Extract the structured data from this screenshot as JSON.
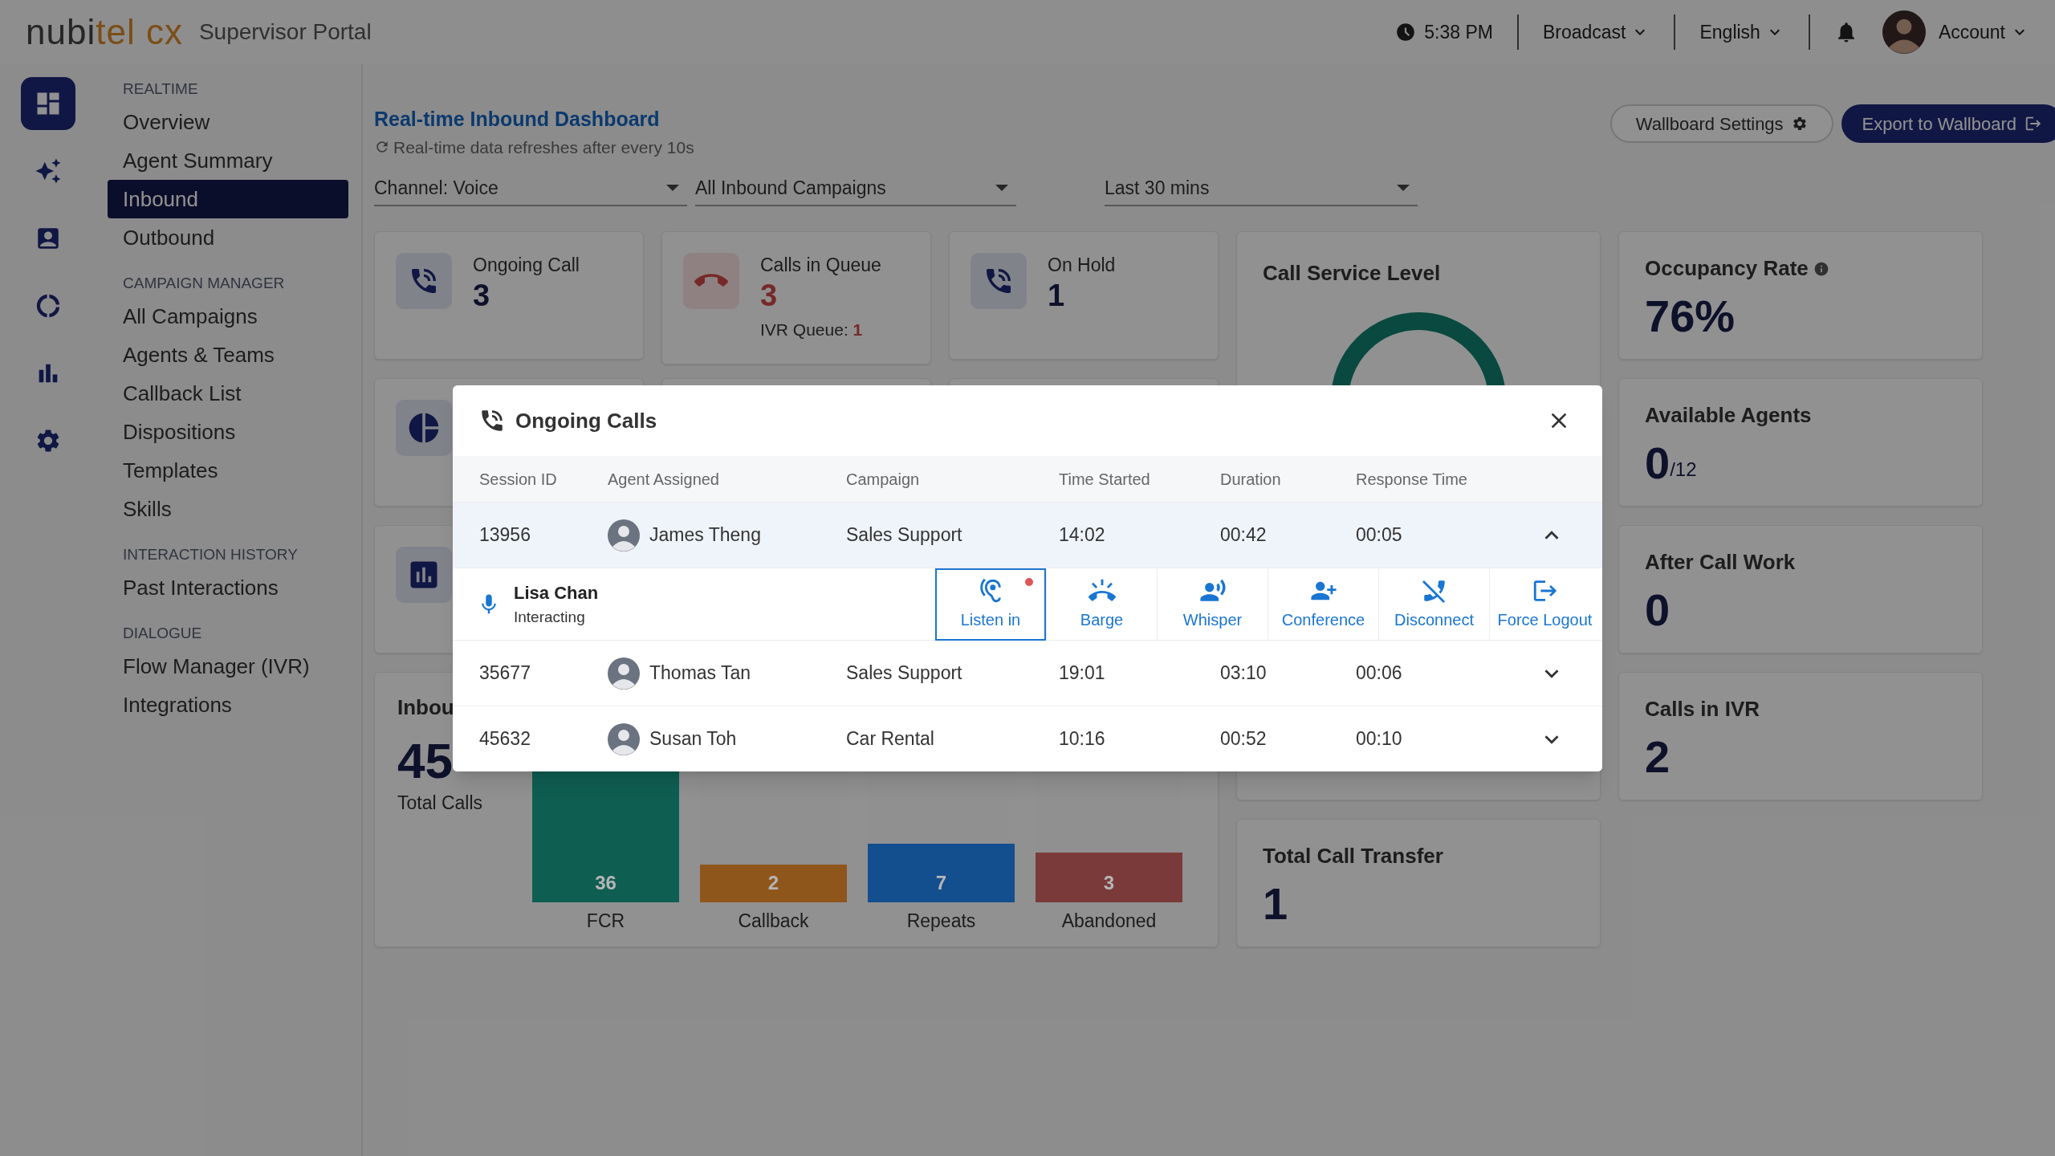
{
  "header": {
    "logo": {
      "main": "nubi",
      "accent": "tel cx"
    },
    "app_name": "Supervisor Portal",
    "time": "5:38 PM",
    "menus": [
      "Broadcast",
      "English"
    ],
    "account": "Account"
  },
  "rail": [
    {
      "selected": true
    },
    {
      "selected": false
    },
    {
      "selected": false
    },
    {
      "selected": false
    },
    {
      "selected": false
    },
    {
      "selected": false
    }
  ],
  "sidebar": [
    {
      "heading": "REALTIME",
      "items": [
        {
          "label": "Overview",
          "selected": false
        },
        {
          "label": "Agent Summary",
          "selected": false
        },
        {
          "label": "Inbound",
          "selected": true
        },
        {
          "label": "Outbound",
          "selected": false
        }
      ]
    },
    {
      "heading": "CAMPAIGN MANAGER",
      "items": [
        {
          "label": "All Campaigns",
          "selected": false
        },
        {
          "label": "Agents & Teams",
          "selected": false
        },
        {
          "label": "Callback List",
          "selected": false
        },
        {
          "label": "Dispositions",
          "selected": false
        },
        {
          "label": "Templates",
          "selected": false
        },
        {
          "label": "Skills",
          "selected": false
        }
      ]
    },
    {
      "heading": "INTERACTION HISTORY",
      "items": [
        {
          "label": "Past Interactions",
          "selected": false
        }
      ]
    },
    {
      "heading": "DIALOGUE",
      "items": [
        {
          "label": "Flow Manager (IVR)",
          "selected": false
        },
        {
          "label": "Integrations",
          "selected": false
        }
      ]
    }
  ],
  "page": {
    "title": "Real-time Inbound Dashboard",
    "subtitle": "Real-time data refreshes after every 10s",
    "buttons": [
      {
        "label": "Wallboard Settings",
        "kind": "outline"
      },
      {
        "label": "Export to Wallboard",
        "kind": "primary"
      }
    ]
  },
  "filters": [
    "Channel: Voice",
    "All Inbound Campaigns",
    "Last 30 mins"
  ],
  "stat_cards": [
    {
      "kind": "normal",
      "title": "Ongoing Call",
      "value": "3"
    },
    {
      "kind": "alert",
      "title": "Calls in Queue",
      "value": "3",
      "sub_label": "IVR Queue:",
      "sub_value": "1"
    },
    {
      "kind": "normal",
      "title": "On Hold",
      "value": "1"
    }
  ],
  "hidden_cards": [
    {
      "kind": "pie"
    },
    {
      "kind": "blank"
    },
    {
      "kind": "blank"
    },
    {
      "kind": "chart"
    },
    {
      "kind": "blank"
    },
    {
      "kind": "blank"
    }
  ],
  "service_level": {
    "title": "Call Service Level"
  },
  "inbound": {
    "title": "Inbou",
    "total": "45",
    "total_label": "Total Calls",
    "bars": [
      {
        "label": "FCR",
        "value": "36",
        "color": "#0f5e52",
        "level": 1
      },
      {
        "label": "Callback",
        "value": "2",
        "color": "#8f561c",
        "level": 0.18
      },
      {
        "label": "Repeats",
        "value": "7",
        "color": "#134f8e",
        "level": 0.28
      },
      {
        "label": "Abandoned",
        "value": "3",
        "color": "#7b3a3a",
        "level": 0.24
      }
    ]
  },
  "transfer": {
    "title": "Total Call Transfer",
    "value": "1"
  },
  "right_cards": [
    {
      "title": "Occupancy Rate",
      "value": "76%",
      "info": true
    },
    {
      "title": "Available Agents",
      "value": "0",
      "suffix": "/12",
      "info": false
    },
    {
      "title": "After Call Work",
      "value": "0",
      "info": false
    },
    {
      "title": "Calls in IVR",
      "value": "2",
      "info": false
    }
  ],
  "modal": {
    "title": "Ongoing Calls",
    "columns": [
      "Session ID",
      "Agent Assigned",
      "Campaign",
      "Time Started",
      "Duration",
      "Response Time"
    ],
    "rows": [
      {
        "session": "13956",
        "agent": "James Theng",
        "campaign": "Sales Support",
        "started": "14:02",
        "duration": "00:42",
        "response": "00:05",
        "expanded": true,
        "detail": {
          "name": "Lisa Chan",
          "status": "Interacting",
          "actions": [
            {
              "label": "Listen in",
              "selected": true,
              "alert": true
            },
            {
              "label": "Barge",
              "selected": false,
              "alert": false
            },
            {
              "label": "Whisper",
              "selected": false,
              "alert": false
            },
            {
              "label": "Conference",
              "selected": false,
              "alert": false
            },
            {
              "label": "Disconnect",
              "selected": false,
              "alert": false
            },
            {
              "label": "Force Logout",
              "selected": false,
              "alert": false
            }
          ]
        }
      },
      {
        "session": "35677",
        "agent": "Thomas Tan",
        "campaign": "Sales Support",
        "started": "19:01",
        "duration": "03:10",
        "response": "00:06",
        "expanded": false
      },
      {
        "session": "45632",
        "agent": "Susan Toh",
        "campaign": "Car Rental",
        "started": "10:16",
        "duration": "00:52",
        "response": "00:10",
        "expanded": false
      }
    ]
  }
}
